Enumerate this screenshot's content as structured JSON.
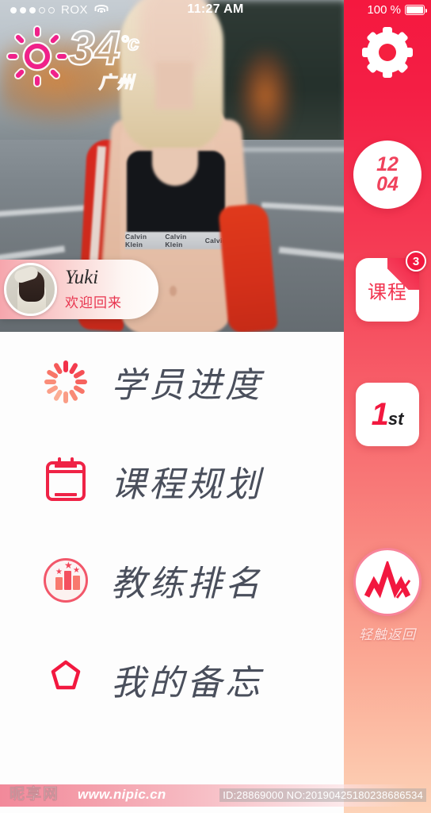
{
  "status_bar": {
    "signal_dots_filled": 3,
    "signal_dots_total": 5,
    "carrier": "ROX",
    "wifi_icon": "wifi-icon",
    "time": "11:27 AM",
    "battery_percent": "100 %",
    "battery_icon": "battery-full-icon"
  },
  "weather": {
    "icon": "sun-icon",
    "temperature": "34",
    "unit": "°c",
    "city": "广州"
  },
  "user_card": {
    "avatar": "user-avatar",
    "name": "Yuki",
    "greeting": "欢迎回来"
  },
  "menu": {
    "items": [
      {
        "icon": "progress-spinner-icon",
        "label": "学员进度"
      },
      {
        "icon": "calendar-icon",
        "label": "课程规划"
      },
      {
        "icon": "podium-ranking-icon",
        "label": "教练排名"
      },
      {
        "icon": "star-outline-icon",
        "label": "我的备忘"
      }
    ]
  },
  "sidebar": {
    "settings": {
      "icon": "gear-icon"
    },
    "date": {
      "top": "12",
      "bottom": "04"
    },
    "course": {
      "label": "课程",
      "badge": "3",
      "icon": "ribbon-corner-icon"
    },
    "rank": {
      "number": "1",
      "suffix": "st"
    },
    "logo": {
      "icon": "brand-logo-icon",
      "back_label": "轻触返回"
    }
  },
  "watermark": {
    "site_name": "昵享网",
    "url": "www.nipic.cn",
    "id_text": "ID:28869000 NO:20190425180238686534"
  },
  "colors": {
    "accent": "#f2183f",
    "accent_soft": "#f8796e",
    "sidebar_top": "#f5183f",
    "sidebar_bottom": "#fdd3b8",
    "menu_text": "#4a4f5c"
  }
}
